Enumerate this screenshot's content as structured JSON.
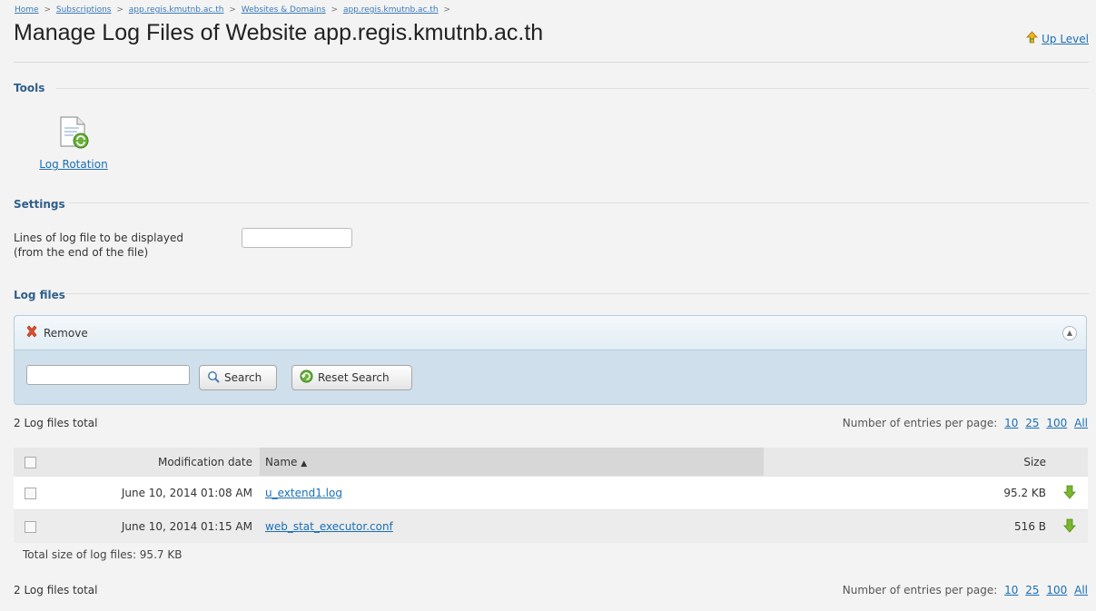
{
  "breadcrumb": {
    "items": [
      "Home",
      "Subscriptions",
      "app.regis.kmutnb.ac.th",
      "Websites & Domains",
      "app.regis.kmutnb.ac.th"
    ],
    "separator": ">"
  },
  "header": {
    "title": "Manage Log Files of Website app.regis.kmutnb.ac.th",
    "up_level": "Up Level"
  },
  "tools": {
    "section_title": "Tools",
    "log_rotation": "Log Rotation"
  },
  "settings": {
    "section_title": "Settings",
    "lines_label_1": "Lines of log file to be displayed",
    "lines_label_2": "(from the end of the file)",
    "lines_value": ""
  },
  "log_files": {
    "section_title": "Log files",
    "remove_label": "Remove",
    "search_value": "",
    "search_button": "Search",
    "reset_button": "Reset Search",
    "total_label": "2 Log files total",
    "per_page_label": "Number of entries per page:",
    "per_page_options": [
      "10",
      "25",
      "100",
      "All"
    ],
    "columns": {
      "date": "Modification date",
      "name": "Name",
      "size": "Size"
    },
    "rows": [
      {
        "date": "June 10, 2014 01:08 AM",
        "name": "u_extend1.log",
        "size": "95.2 KB"
      },
      {
        "date": "June 10, 2014 01:15 AM",
        "name": "web_stat_executor.conf",
        "size": "516 B"
      }
    ],
    "total_size": "Total size of log files: 95.7 KB"
  },
  "colors": {
    "link": "#1a6fb5",
    "section_title": "#2f5f8a",
    "panel_bg": "#dfeaf2",
    "download_green": "#7ab62e"
  },
  "icons": [
    "up-arrow-icon",
    "log-rotation-icon",
    "remove-x-icon",
    "collapse-icon",
    "search-icon",
    "reset-icon",
    "sort-up-icon",
    "download-arrow-icon"
  ]
}
